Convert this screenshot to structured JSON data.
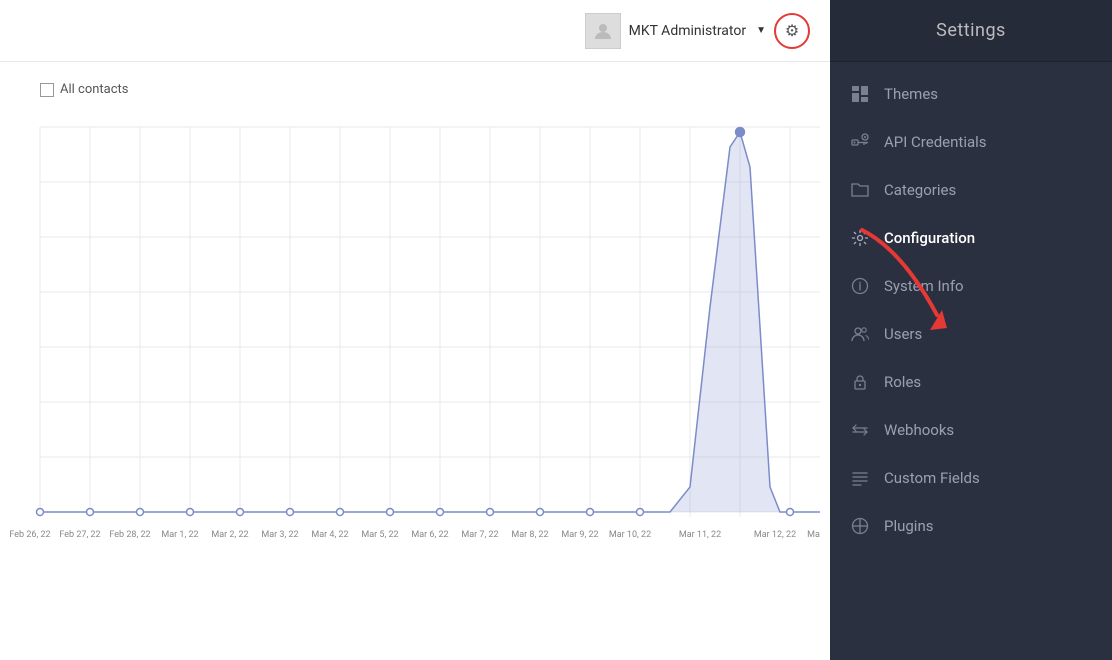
{
  "header": {
    "user_name": "MKT Administrator",
    "dropdown_arrow": "▼",
    "gear_label": "⚙"
  },
  "sidebar": {
    "title": "Settings",
    "items": [
      {
        "id": "themes",
        "label": "Themes",
        "icon": "📋",
        "active": false
      },
      {
        "id": "api-credentials",
        "label": "API Credentials",
        "icon": "🧩",
        "active": false
      },
      {
        "id": "categories",
        "label": "Categories",
        "icon": "📁",
        "active": false
      },
      {
        "id": "configuration",
        "label": "Configuration",
        "icon": "⚙",
        "active": true
      },
      {
        "id": "system-info",
        "label": "System Info",
        "icon": "🔘",
        "active": false
      },
      {
        "id": "users",
        "label": "Users",
        "icon": "👥",
        "active": false
      },
      {
        "id": "roles",
        "label": "Roles",
        "icon": "🔒",
        "active": false
      },
      {
        "id": "webhooks",
        "label": "Webhooks",
        "icon": "⇄",
        "active": false
      },
      {
        "id": "custom-fields",
        "label": "Custom Fields",
        "icon": "☰",
        "active": false
      },
      {
        "id": "plugins",
        "label": "Plugins",
        "icon": "⊕",
        "active": false
      }
    ]
  },
  "chart": {
    "legend_label": "All contacts",
    "x_labels": [
      "Feb 26, 22",
      "Feb 27, 22",
      "Feb 28, 22",
      "Mar 1, 22",
      "Mar 2, 22",
      "Mar 3, 22",
      "Mar 4, 22",
      "Mar 5, 22",
      "Mar 6, 22",
      "Mar 7, 22",
      "Mar 8, 22",
      "Mar 9, 22",
      "Mar 10, 22",
      "Mar 11, 22",
      "Mar 12, 22",
      "Mar"
    ]
  }
}
